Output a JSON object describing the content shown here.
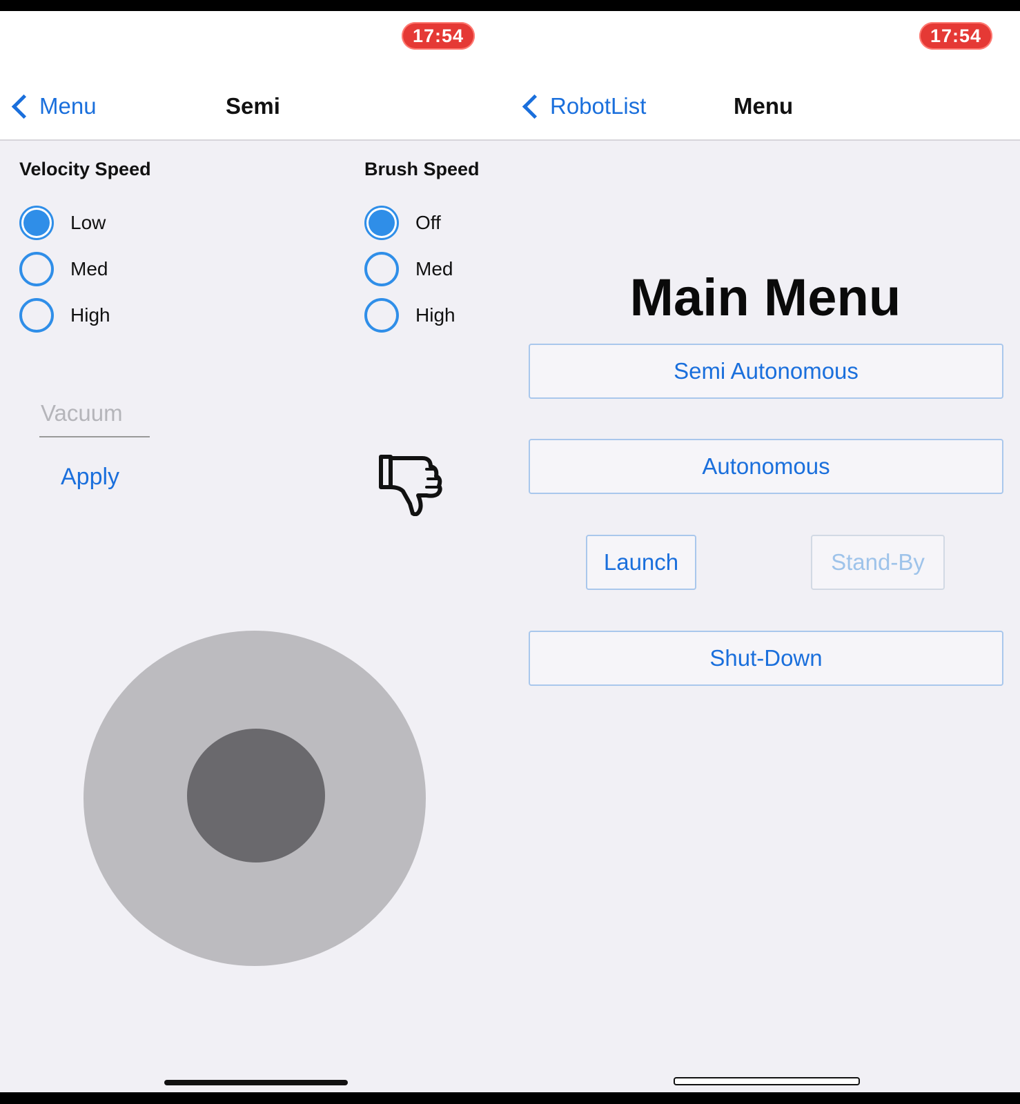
{
  "left_screen": {
    "status_time": "17:54",
    "nav": {
      "back_label": "Menu",
      "title": "Semi"
    },
    "velocity": {
      "title": "Velocity Speed",
      "options": [
        "Low",
        "Med",
        "High"
      ],
      "selected": "Low"
    },
    "brush": {
      "title": "Brush Speed",
      "options": [
        "Off",
        "Med",
        "High"
      ],
      "selected": "Off"
    },
    "vacuum_placeholder": "Vacuum",
    "apply_label": "Apply",
    "thumbs_icon": "thumbs-down-icon"
  },
  "right_screen": {
    "status_time": "17:54",
    "nav": {
      "back_label": "RobotList",
      "title": "Menu"
    },
    "heading": "Main Menu",
    "buttons": {
      "semi": "Semi Autonomous",
      "auto": "Autonomous",
      "launch": "Launch",
      "standby": "Stand-By",
      "shutdown": "Shut-Down"
    }
  },
  "colors": {
    "accent": "#1a6fdc",
    "radio": "#2f8ee8",
    "time_pill": "#e53935",
    "background": "#f1f0f5"
  }
}
